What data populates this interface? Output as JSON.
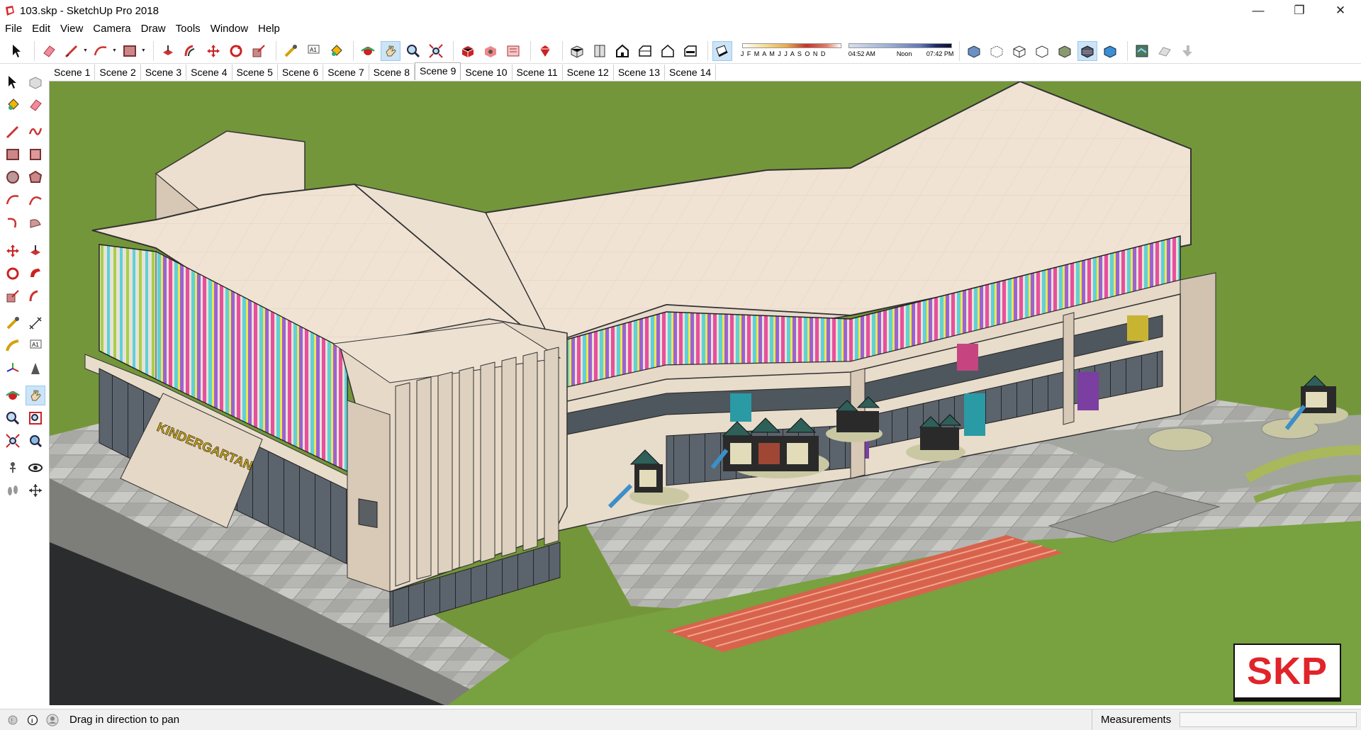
{
  "window": {
    "title": "103.skp - SketchUp Pro 2018",
    "controls": [
      "—",
      "❐",
      "✕"
    ]
  },
  "menu": [
    "File",
    "Edit",
    "View",
    "Camera",
    "Draw",
    "Tools",
    "Window",
    "Help"
  ],
  "shadow_settings": {
    "months": "J F M A M J J A S O N D",
    "time_start": "04:52 AM",
    "time_mid": "Noon",
    "time_end": "07:42 PM"
  },
  "scenes": {
    "tabs": [
      "Scene 1",
      "Scene 2",
      "Scene 3",
      "Scene 4",
      "Scene 5",
      "Scene 6",
      "Scene 7",
      "Scene 8",
      "Scene 9",
      "Scene 10",
      "Scene 11",
      "Scene 12",
      "Scene 13",
      "Scene 14"
    ],
    "active": "Scene 9"
  },
  "model": {
    "sign_text": "KINDERGARTAN",
    "watermark": "SKP"
  },
  "status": {
    "hint": "Drag in direction to pan",
    "measurements_label": "Measurements",
    "measurements_value": ""
  },
  "colors": {
    "ground": "#74963a",
    "roof": "#efe3d4",
    "wall": "#e6d9c8",
    "glass": "#4a5058",
    "plaza": "#b8b8b4",
    "track": "#d65a45",
    "accent_red": "#e0242a"
  }
}
